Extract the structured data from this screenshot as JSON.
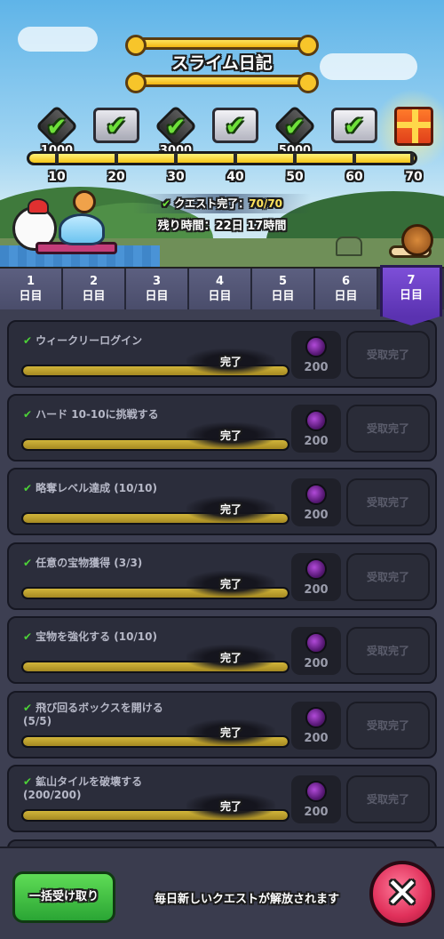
{
  "header": {
    "title": "スライム日記",
    "quest_complete_label": "クエスト完了：",
    "quest_complete_value": "70/70",
    "remaining_time": "残り時間：22日 17時間"
  },
  "progress": {
    "current": 70,
    "max": 70,
    "milestone_values": [
      "1000",
      "3000",
      "5000"
    ],
    "step_labels": [
      "10",
      "20",
      "30",
      "40",
      "50",
      "60",
      "70"
    ]
  },
  "tabs": [
    {
      "num": "1",
      "suffix": "日目"
    },
    {
      "num": "2",
      "suffix": "日目"
    },
    {
      "num": "3",
      "suffix": "日目"
    },
    {
      "num": "4",
      "suffix": "日目"
    },
    {
      "num": "5",
      "suffix": "日目"
    },
    {
      "num": "6",
      "suffix": "日目"
    },
    {
      "num": "7",
      "suffix": "日目"
    }
  ],
  "quests": [
    {
      "name": "ウィークリーログイン",
      "status": "完了",
      "reward": "200",
      "claim": "受取完了",
      "progress": 1.0
    },
    {
      "name": "ハード 10-10に挑戦する",
      "status": "完了",
      "reward": "200",
      "claim": "受取完了",
      "progress": 1.0
    },
    {
      "name": "略奪レベル達成 (10/10)",
      "status": "完了",
      "reward": "200",
      "claim": "受取完了",
      "progress": 1.0
    },
    {
      "name": "任意の宝物獲得 (3/3)",
      "status": "完了",
      "reward": "200",
      "claim": "受取完了",
      "progress": 1.0
    },
    {
      "name": "宝物を強化する (10/10)",
      "status": "完了",
      "reward": "200",
      "claim": "受取完了",
      "progress": 1.0
    },
    {
      "name": "飛び回るボックスを開ける\n(5/5)",
      "status": "完了",
      "reward": "200",
      "claim": "受取完了",
      "progress": 1.0
    },
    {
      "name": "鉱山タイルを破壊する\n(200/200)",
      "status": "完了",
      "reward": "200",
      "claim": "受取完了",
      "progress": 1.0
    }
  ],
  "footer": {
    "claim_all": "一括受け取り",
    "notice": "毎日新しいクエストが解放されます",
    "close": "✕"
  },
  "colors": {
    "accent_green": "#6ee03a",
    "progress_yellow": "#f5c518",
    "active_tab_purple": "#7d4fd8",
    "close_pink": "#e0305a"
  }
}
